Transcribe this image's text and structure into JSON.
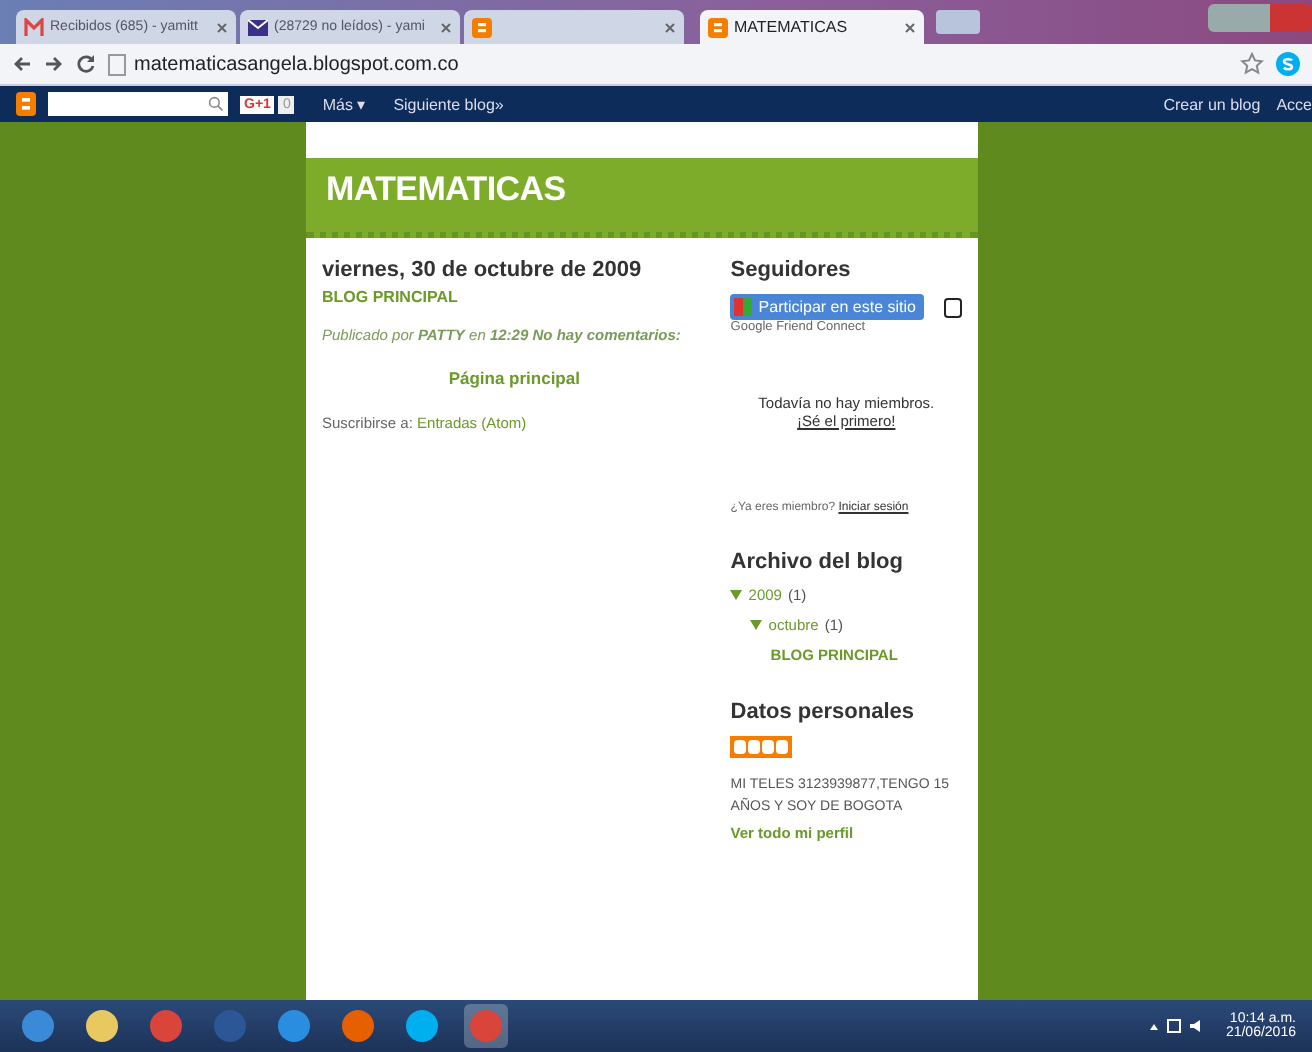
{
  "browser": {
    "tabs": [
      {
        "title": "Recibidos (685) - yamitt",
        "selected": false
      },
      {
        "title": "(28729 no leídos) - yami",
        "selected": false
      },
      {
        "selected": false
      },
      {
        "title": "MATEMATICAS",
        "selected": true
      }
    ],
    "address": "matematicasangela.blogspot.com.co"
  },
  "navbar": {
    "plus_one": "G+1",
    "share_count": "0",
    "more": "Más ▾",
    "next": "Siguiente blog»",
    "create": "Crear un blog",
    "access": "Acce"
  },
  "blog": {
    "title": "MATEMATICAS",
    "post": {
      "date": "viernes, 30 de octubre de 2009",
      "title": "BLOG PRINCIPAL",
      "footer": "Publicado por **PATTY** en **12:29** **No hay comentarios:**",
      "home": "Página principal",
      "subscribe": "Suscribirse a:",
      "feed": "Entradas (Atom)"
    },
    "followers": {
      "heading": "Seguidores",
      "join": "Participar en este sitio",
      "gfc": "Google Friend Connect",
      "none": "Todavía no hay miembros.",
      "first": "¡Sé el primero!",
      "member": "¿Ya eres miembro?",
      "login": "Iniciar sesión"
    },
    "archive": {
      "heading": "Archivo del blog",
      "tree": [
        {
          "label": "2009",
          "count": "(1)",
          "expanded": true,
          "children": [
            {
              "label": "octubre",
              "count": "(1)",
              "expanded": true,
              "children": [
                {
                  "label": "BLOG PRINCIPAL"
                }
              ]
            }
          ]
        }
      ]
    },
    "profile": {
      "heading": "Datos personales",
      "about": "MI TELES 3123939877,TENGO 15 AÑOS Y SOY DE BOGOTA",
      "link": "Ver todo mi perfil"
    }
  },
  "taskbar": {
    "time": "10:14 a.m.",
    "date": "21/06/2016"
  }
}
